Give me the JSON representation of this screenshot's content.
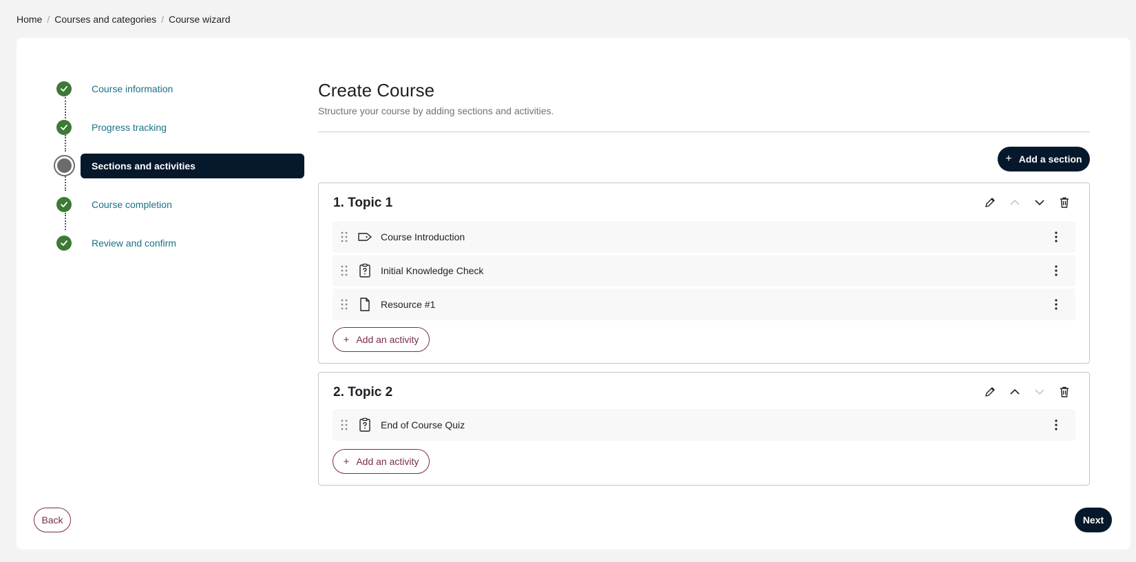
{
  "breadcrumb": {
    "items": [
      "Home",
      "Courses and categories",
      "Course wizard"
    ],
    "separator": "/"
  },
  "stepper": {
    "steps": [
      {
        "label": "Course information",
        "state": "complete"
      },
      {
        "label": "Progress tracking",
        "state": "complete"
      },
      {
        "label": "Sections and activities",
        "state": "current"
      },
      {
        "label": "Course completion",
        "state": "complete"
      },
      {
        "label": "Review and confirm",
        "state": "complete"
      }
    ]
  },
  "main": {
    "title": "Create Course",
    "subtitle": "Structure your course by adding sections and activities.",
    "add_section_label": "Add a section",
    "sections": [
      {
        "title": "1. Topic 1",
        "move_up_disabled": true,
        "move_down_disabled": false,
        "activities": [
          {
            "name": "Course Introduction",
            "icon": "label-icon"
          },
          {
            "name": "Initial Knowledge Check",
            "icon": "quiz-icon"
          },
          {
            "name": "Resource #1",
            "icon": "file-icon"
          }
        ],
        "add_activity_label": "Add an activity"
      },
      {
        "title": "2. Topic 2",
        "move_up_disabled": false,
        "move_down_disabled": true,
        "activities": [
          {
            "name": "End of Course Quiz",
            "icon": "quiz-icon"
          }
        ],
        "add_activity_label": "Add an activity"
      }
    ]
  },
  "footer": {
    "back_label": "Back",
    "next_label": "Next"
  },
  "colors": {
    "primary_dark": "#06182b",
    "complete_green": "#3c7a35",
    "link_teal": "#1a7086",
    "outline_maroon": "#7a2b4f"
  }
}
